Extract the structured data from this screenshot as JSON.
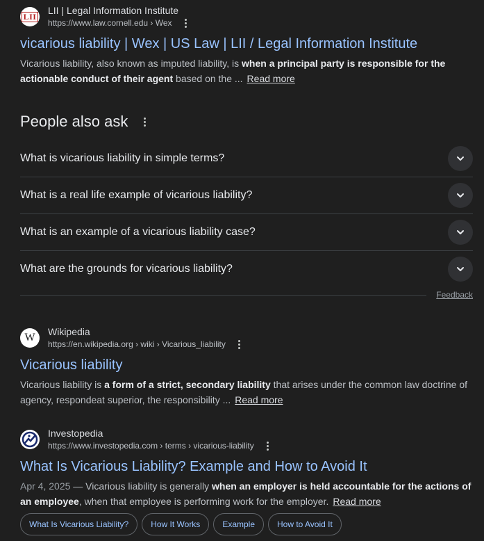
{
  "results": [
    {
      "site_name": "LII | Legal Information Institute",
      "url": "https://www.law.cornell.edu › Wex",
      "title": "vicarious liability | Wex | US Law | LII / Legal Information Institute",
      "snippet_parts": [
        "Vicarious liability, also known as imputed liability, is ",
        "when a principal party is responsible for the actionable conduct of their agent",
        " based on the ..."
      ],
      "read_more": "Read more",
      "favicon_text": "LII",
      "favicon_icon": "lii-logo-icon"
    },
    {
      "site_name": "Wikipedia",
      "url": "https://en.wikipedia.org › wiki › Vicarious_liability",
      "title": "Vicarious liability",
      "snippet_parts": [
        "Vicarious liability is ",
        "a form of a strict, secondary liability",
        " that arises under the common law doctrine of agency, respondeat superior, the responsibility ..."
      ],
      "read_more": "Read more",
      "favicon_text": "W",
      "favicon_icon": "wikipedia-logo-icon"
    },
    {
      "site_name": "Investopedia",
      "url": "https://www.investopedia.com › terms › vicarious-liability",
      "title": "What Is Vicarious Liability? Example and How to Avoid It",
      "date": "Apr 4, 2025",
      "snippet_parts": [
        " — Vicarious liability is generally ",
        "when an employer is held accountable for the actions of an employee",
        ", when that employee is performing work for the employer."
      ],
      "read_more": "Read more",
      "favicon_icon": "investopedia-logo-icon",
      "chips": [
        "What Is Vicarious Liability?",
        "How It Works",
        "Example",
        "How to Avoid It"
      ]
    }
  ],
  "people_also_ask": {
    "title": "People also ask",
    "questions": [
      "What is vicarious liability in simple terms?",
      "What is a real life example of vicarious liability?",
      "What is an example of a vicarious liability case?",
      "What are the grounds for vicarious liability?"
    ],
    "feedback": "Feedback",
    "expand_icon": "chevron-down-icon"
  },
  "colors": {
    "background": "#1f1f1f",
    "link": "#99c3ff",
    "text": "#bdc1c6",
    "divider": "#3c4043"
  }
}
